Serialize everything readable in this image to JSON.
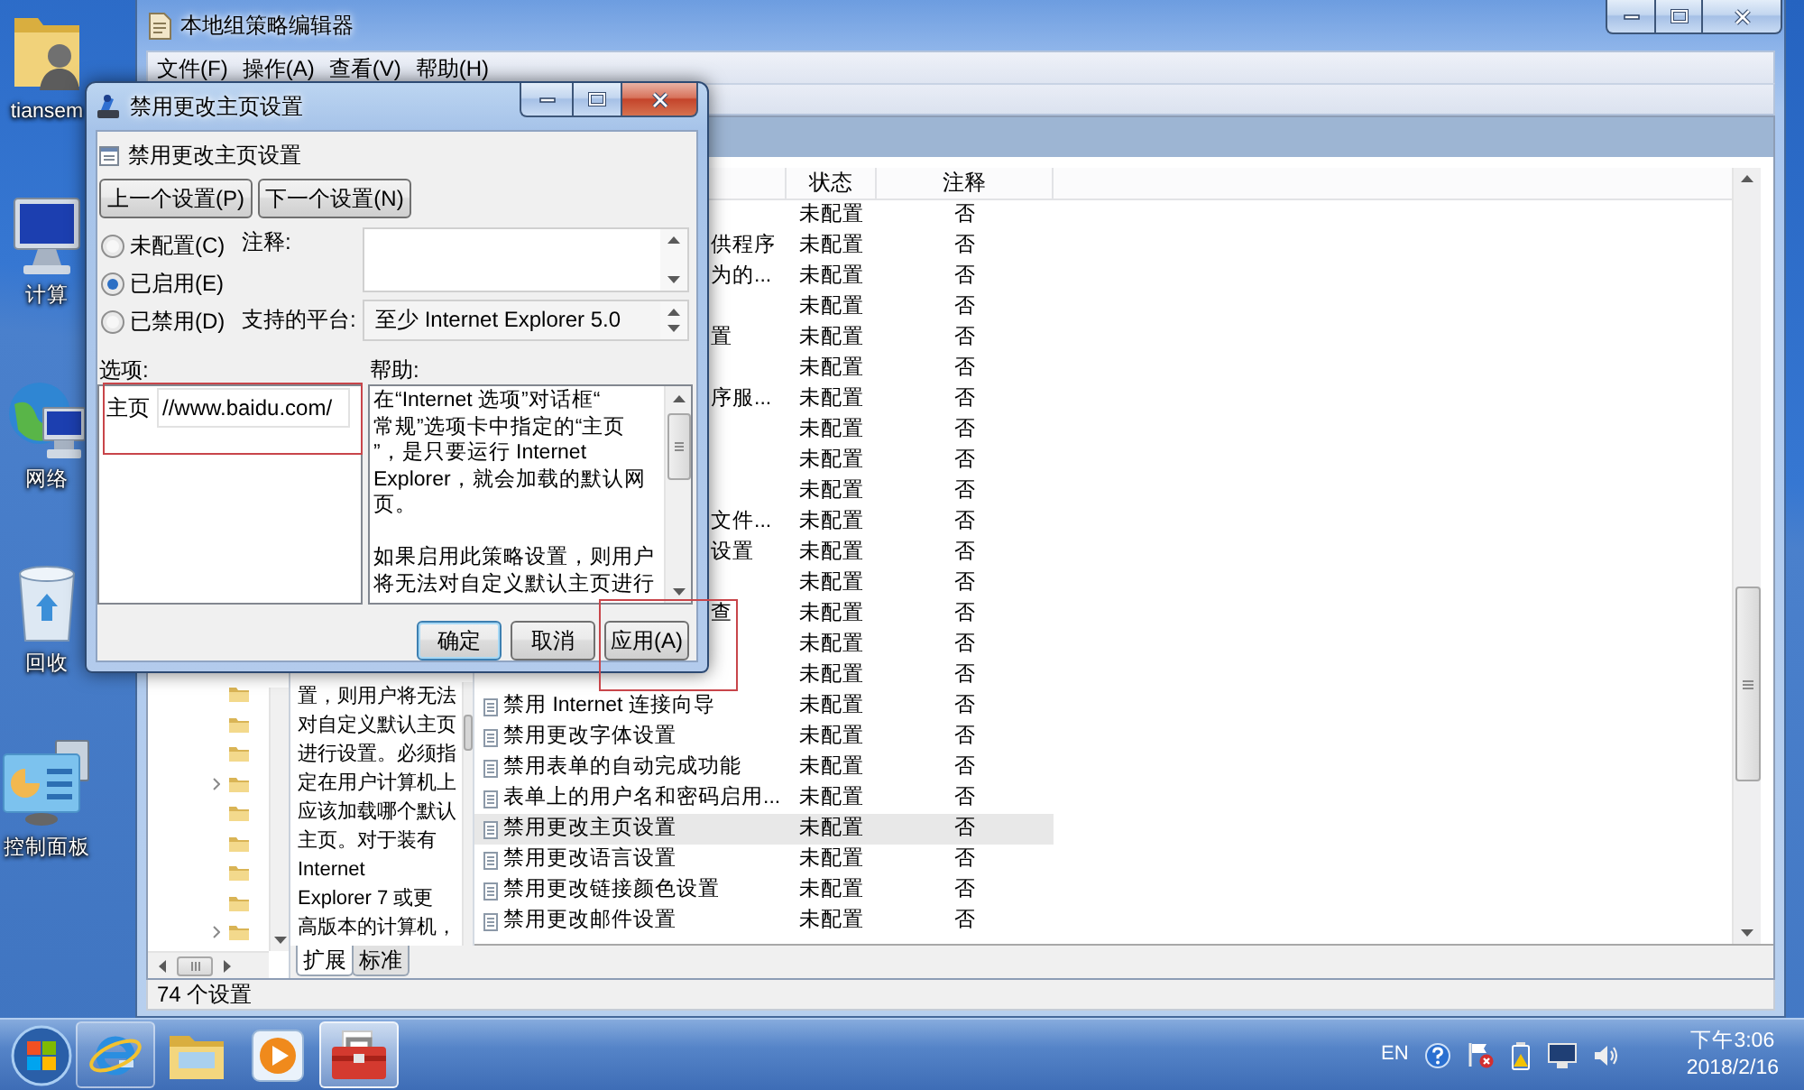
{
  "desktop": {
    "icons": [
      {
        "kind": "user-folder",
        "label": "tiansem"
      },
      {
        "kind": "computer",
        "label": "计算"
      },
      {
        "kind": "network",
        "label": "网络"
      },
      {
        "kind": "recycle-bin",
        "label": "回收"
      },
      {
        "kind": "control-panel",
        "label": "控制面板"
      }
    ]
  },
  "main_window": {
    "title": "本地组策略编辑器",
    "active": false,
    "menu": [
      "文件(F)",
      "操作(A)",
      "查看(V)",
      "帮助(H)"
    ],
    "tree": {
      "items": [
        {
          "has_children": false
        },
        {
          "has_children": false
        },
        {
          "has_children": false
        },
        {
          "has_children": true
        },
        {
          "has_children": false
        },
        {
          "has_children": false
        },
        {
          "has_children": false
        },
        {
          "has_children": false
        },
        {
          "has_children": true
        }
      ]
    },
    "description": {
      "lines": [
        "置，则用户将无法",
        "对自定义默认主页",
        "进行设置。必须指",
        "定在用户计算机上",
        "应该加载哪个默认",
        "主页。对于装有",
        "Internet",
        "Explorer 7 或更",
        "高版本的计算机，"
      ]
    },
    "table": {
      "columns": [
        "状态",
        "注释"
      ],
      "rows": [
        {
          "kind": "clipped",
          "selected": false,
          "status": "未配置",
          "note": "否"
        },
        {
          "kind": "clipped",
          "name": "供程序",
          "selected": false,
          "status": "未配置",
          "note": "否"
        },
        {
          "kind": "clipped",
          "name": "为的...",
          "selected": false,
          "status": "未配置",
          "note": "否"
        },
        {
          "kind": "clipped",
          "selected": false,
          "status": "未配置",
          "note": "否"
        },
        {
          "kind": "clipped",
          "name": "置",
          "selected": false,
          "status": "未配置",
          "note": "否"
        },
        {
          "kind": "clipped",
          "selected": false,
          "status": "未配置",
          "note": "否"
        },
        {
          "kind": "clipped",
          "name": "序服...",
          "selected": false,
          "status": "未配置",
          "note": "否"
        },
        {
          "kind": "clipped",
          "selected": false,
          "status": "未配置",
          "note": "否"
        },
        {
          "kind": "clipped",
          "selected": false,
          "status": "未配置",
          "note": "否"
        },
        {
          "kind": "clipped",
          "selected": false,
          "status": "未配置",
          "note": "否"
        },
        {
          "kind": "clipped",
          "name": "文件...",
          "selected": false,
          "status": "未配置",
          "note": "否"
        },
        {
          "kind": "clipped",
          "name": "设置",
          "selected": false,
          "status": "未配置",
          "note": "否"
        },
        {
          "kind": "clipped",
          "selected": false,
          "status": "未配置",
          "note": "否"
        },
        {
          "kind": "clipped",
          "name": "查",
          "selected": false,
          "status": "未配置",
          "note": "否"
        },
        {
          "kind": "clipped",
          "selected": false,
          "status": "未配置",
          "note": "否"
        },
        {
          "kind": "clipped",
          "selected": false,
          "status": "未配置",
          "note": "否"
        },
        {
          "kind": "setting",
          "name": "禁用 Internet 连接向导",
          "selected": false,
          "status": "未配置",
          "note": "否"
        },
        {
          "kind": "setting",
          "name": "禁用更改字体设置",
          "selected": false,
          "status": "未配置",
          "note": "否"
        },
        {
          "kind": "setting",
          "name": "禁用表单的自动完成功能",
          "selected": false,
          "status": "未配置",
          "note": "否"
        },
        {
          "kind": "setting",
          "name": "表单上的用户名和密码启用...",
          "selected": false,
          "status": "未配置",
          "note": "否"
        },
        {
          "kind": "setting",
          "name": "禁用更改主页设置",
          "selected": true,
          "status": "未配置",
          "note": "否"
        },
        {
          "kind": "setting",
          "name": "禁用更改语言设置",
          "selected": false,
          "status": "未配置",
          "note": "否"
        },
        {
          "kind": "setting",
          "name": "禁用更改链接颜色设置",
          "selected": false,
          "status": "未配置",
          "note": "否"
        },
        {
          "kind": "setting",
          "name": "禁用更改邮件设置",
          "selected": false,
          "status": "未配置",
          "note": "否"
        }
      ]
    },
    "tabs": [
      {
        "label": "扩展",
        "selected": true
      },
      {
        "label": "标准",
        "selected": false
      }
    ],
    "status_bar": "74 个设置"
  },
  "dialog": {
    "title": "禁用更改主页设置",
    "active": true,
    "heading": "禁用更改主页设置",
    "nav_buttons": [
      "上一个设置(P)",
      "下一个设置(N)"
    ],
    "radios": [
      {
        "label": "未配置(C)",
        "selected": false
      },
      {
        "label": "已启用(E)",
        "selected": true
      },
      {
        "label": "已禁用(D)",
        "selected": false
      }
    ],
    "comment": {
      "label": "注释:"
    },
    "platform": {
      "label": "支持的平台:",
      "value": "至少 Internet Explorer 5.0"
    },
    "options": {
      "label": "选项:",
      "items": [
        {
          "label": "主页",
          "value": "//www.baidu.com/",
          "highlighted": true
        }
      ]
    },
    "help": {
      "label": "帮助:",
      "paragraphs": [
        {
          "lines": [
            "在“Internet 选项”对话框“",
            "常规”选项卡中指定的“主页",
            "”，是只要运行 Internet",
            "Explorer，就会加载的默认网",
            "页。"
          ]
        },
        {
          "lines": [
            "如果启用此策略设置，则用户",
            "将无法对自定义默认主页进行"
          ]
        }
      ]
    },
    "buttons": [
      {
        "label": "确定",
        "default": true,
        "highlighted": false
      },
      {
        "label": "取消",
        "default": false,
        "highlighted": false
      },
      {
        "label": "应用(A)",
        "default": false,
        "highlighted": true
      }
    ]
  },
  "taskbar": {
    "apps": [
      {
        "kind": "browser",
        "running": true,
        "active": false
      },
      {
        "kind": "folder",
        "running": false,
        "active": false
      },
      {
        "kind": "media",
        "running": false,
        "active": false
      },
      {
        "kind": "toolbox",
        "running": true,
        "active": true
      }
    ],
    "tray": {
      "language": "EN",
      "time": "下午3:06",
      "date": "2018/2/16"
    }
  }
}
